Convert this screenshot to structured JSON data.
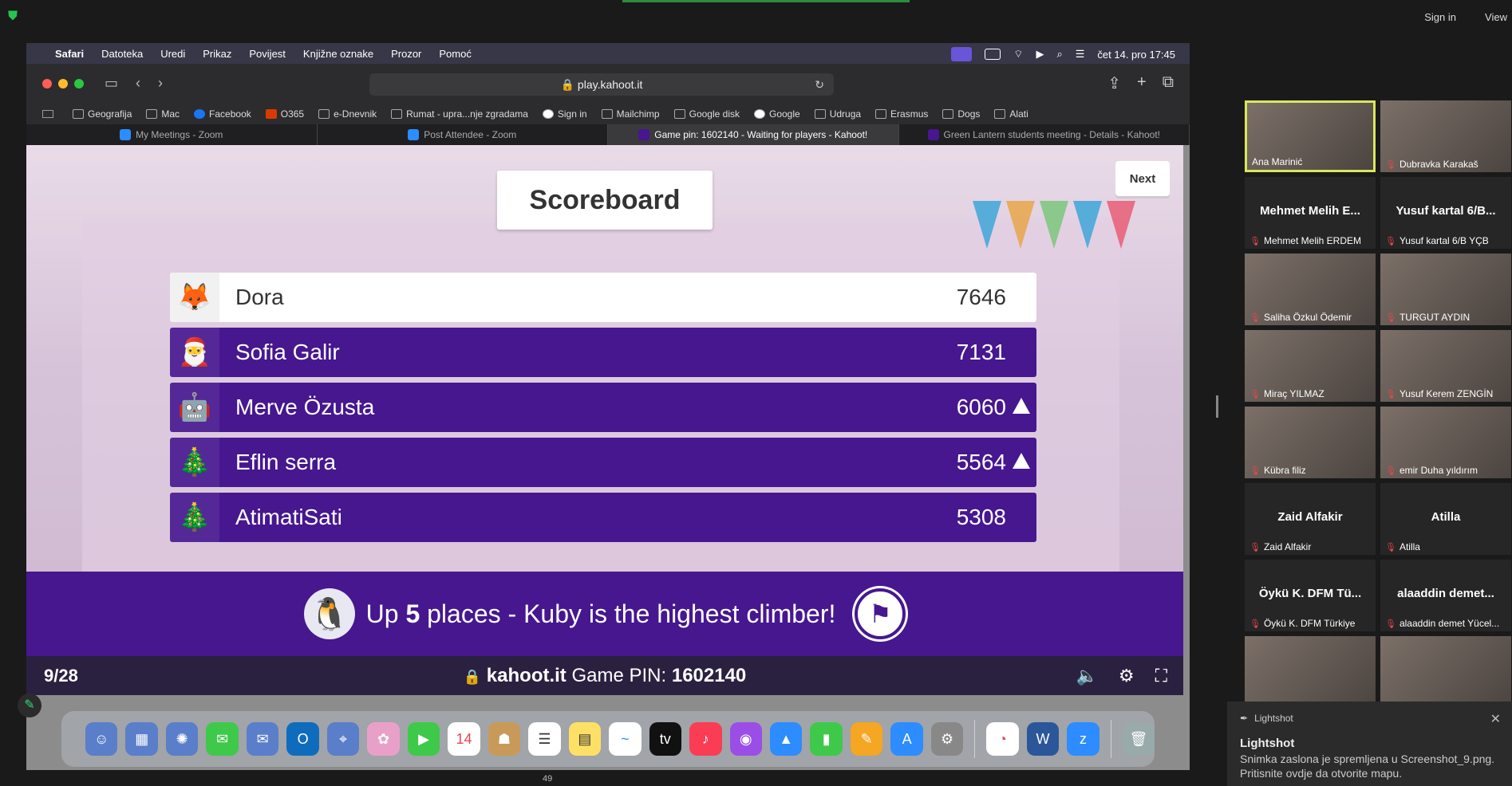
{
  "zoom": {
    "sign_in": "Sign in",
    "view": "View",
    "participants_count": "49"
  },
  "mac_menu": {
    "items": [
      "Safari",
      "Datoteka",
      "Uredi",
      "Prikaz",
      "Povijest",
      "Knjižne oznake",
      "Prozor",
      "Pomoć"
    ],
    "clock": "čet 14. pro 17:45"
  },
  "safari": {
    "url": "play.kahoot.it",
    "bookmarks": [
      "Geografija",
      "Mac",
      "Facebook",
      "O365",
      "e-Dnevnik",
      "Rumat - upra...nje zgradama",
      "Sign in",
      "Mailchimp",
      "Google disk",
      "Google",
      "Udruga",
      "Erasmus",
      "Dogs",
      "Alati"
    ],
    "tabs": [
      {
        "label": "My Meetings - Zoom",
        "active": false
      },
      {
        "label": "Post Attendee - Zoom",
        "active": false
      },
      {
        "label": "Game pin: 1602140 - Waiting for players - Kahoot!",
        "active": true
      },
      {
        "label": "Green Lantern students meeting - Details - Kahoot!",
        "active": false
      }
    ]
  },
  "kahoot": {
    "title": "Scoreboard",
    "next_label": "Next",
    "players": [
      {
        "name": "Dora",
        "score": "7646",
        "avatar": "🦊",
        "up": false
      },
      {
        "name": "Sofia Galir",
        "score": "7131",
        "avatar": "🎅",
        "up": false
      },
      {
        "name": "Merve Özusta",
        "score": "6060",
        "avatar": "🤖",
        "up": true
      },
      {
        "name": "Eflin serra",
        "score": "5564",
        "avatar": "🎄",
        "up": true
      },
      {
        "name": "AtimatiSati",
        "score": "5308",
        "avatar": "🎄",
        "up": false
      }
    ],
    "climber_pre": "Up",
    "climber_num": "5",
    "climber_post": "places - Kuby is the highest climber!",
    "question_count": "9/28",
    "pin_site": "kahoot.it",
    "pin_label": "Game PIN:",
    "pin_value": "1602140"
  },
  "gallery": [
    {
      "name": "Ana Marinić",
      "big": "",
      "video": true,
      "active": true,
      "muted": false
    },
    {
      "name": "Dubravka Karakaš",
      "big": "",
      "video": true,
      "active": false,
      "muted": true
    },
    {
      "name": "Mehmet Melih ERDEM",
      "big": "Mehmet Melih E...",
      "video": false,
      "active": false,
      "muted": true
    },
    {
      "name": "Yusuf kartal 6/B YÇB",
      "big": "Yusuf kartal 6/B...",
      "video": false,
      "active": false,
      "muted": true
    },
    {
      "name": "Saliha Özkul Ödemir",
      "big": "",
      "video": true,
      "active": false,
      "muted": true
    },
    {
      "name": "TURGUT AYDIN",
      "big": "",
      "video": true,
      "active": false,
      "muted": true
    },
    {
      "name": "Miraç YILMAZ",
      "big": "",
      "video": true,
      "active": false,
      "muted": true
    },
    {
      "name": "Yusuf Kerem ZENGİN",
      "big": "",
      "video": true,
      "active": false,
      "muted": true
    },
    {
      "name": "Kübra filiz",
      "big": "",
      "video": true,
      "active": false,
      "muted": true
    },
    {
      "name": "emir Duha yıldırım",
      "big": "",
      "video": true,
      "active": false,
      "muted": true
    },
    {
      "name": "Zaid Alfakir",
      "big": "Zaid Alfakir",
      "video": false,
      "active": false,
      "muted": true
    },
    {
      "name": "Atilla",
      "big": "Atilla",
      "video": false,
      "active": false,
      "muted": true
    },
    {
      "name": "Öykü K. DFM Türkiye",
      "big": "Öykü K. DFM Tü...",
      "video": false,
      "active": false,
      "muted": true
    },
    {
      "name": "alaaddin demet Yücel...",
      "big": "alaaddin demet...",
      "video": false,
      "active": false,
      "muted": true
    },
    {
      "name": "",
      "big": "",
      "video": true,
      "active": false,
      "muted": false
    },
    {
      "name": "",
      "big": "",
      "video": true,
      "active": false,
      "muted": false
    }
  ],
  "toast": {
    "app": "Lightshot",
    "title": "Lightshot",
    "message": "Snimka zaslona je spremljena u Screenshot_9.png. Pritisnite ovdje da otvorite mapu."
  }
}
